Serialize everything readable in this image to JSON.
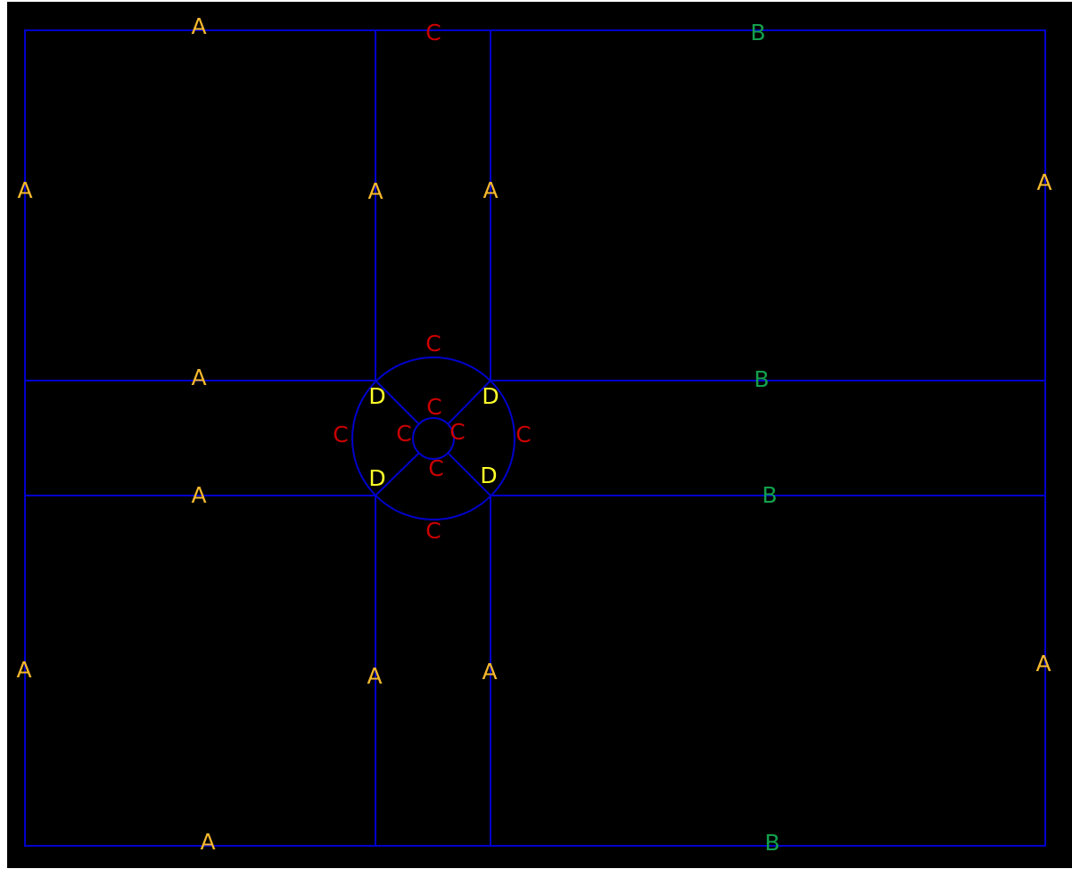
{
  "colors": {
    "background": "#000000",
    "line": "#0000cc",
    "label_A": "#f5b82e",
    "label_B": "#12a04c",
    "label_C": "#cc0000",
    "label_D": "#ffff2a"
  },
  "labels": {
    "top_left": "A",
    "top_mid": "C",
    "top_right": "B",
    "left_upper": "A",
    "inner_left_upper": "A",
    "inner_right_upper": "A",
    "right_upper": "A",
    "circle_top": "C",
    "mid_upper_left": "A",
    "mid_upper_right": "B",
    "d_top_left": "D",
    "d_top_right": "D",
    "circle_left": "C",
    "circle_right": "C",
    "inner_c_top": "C",
    "inner_c_left": "C",
    "inner_c_right": "C",
    "inner_c_bottom": "C",
    "d_bottom_left": "D",
    "d_bottom_right": "D",
    "mid_lower_left": "A",
    "mid_lower_right": "B",
    "circle_bottom": "C",
    "left_lower": "A",
    "inner_left_lower": "A",
    "inner_right_lower": "A",
    "right_lower": "A",
    "bottom_left": "A",
    "bottom_right": "B"
  }
}
